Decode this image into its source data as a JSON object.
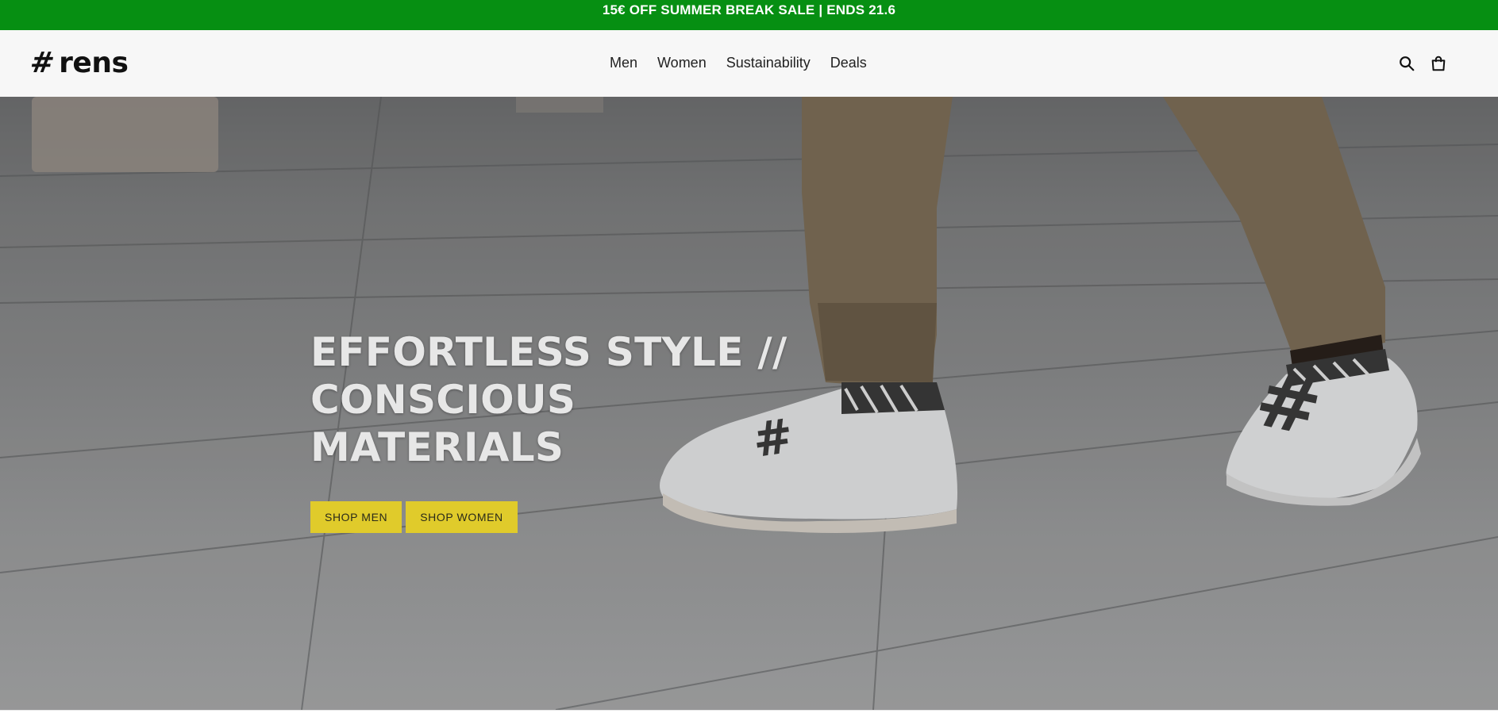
{
  "announcement": {
    "text": "15€ OFF SUMMER BREAK SALE | ENDS 21.6"
  },
  "header": {
    "logo": {
      "mark": "#",
      "word": "rens"
    },
    "nav": [
      {
        "label": "Men"
      },
      {
        "label": "Women"
      },
      {
        "label": "Sustainability"
      },
      {
        "label": "Deals"
      }
    ],
    "icons": [
      "search-icon",
      "cart-icon"
    ]
  },
  "hero": {
    "title_line1": "EFFORTLESS STYLE // CONSCIOUS",
    "title_line2": "MATERIALS",
    "buttons": [
      {
        "label": "SHOP MEN"
      },
      {
        "label": "SHOP WOMEN"
      }
    ],
    "image_subject": "sneaker-walking-photo"
  },
  "colors": {
    "announcement_bg": "#068f12",
    "header_bg": "#f7f7f7",
    "button_bg": "#e0cb2b",
    "hero_text": "#e7e7e7"
  }
}
